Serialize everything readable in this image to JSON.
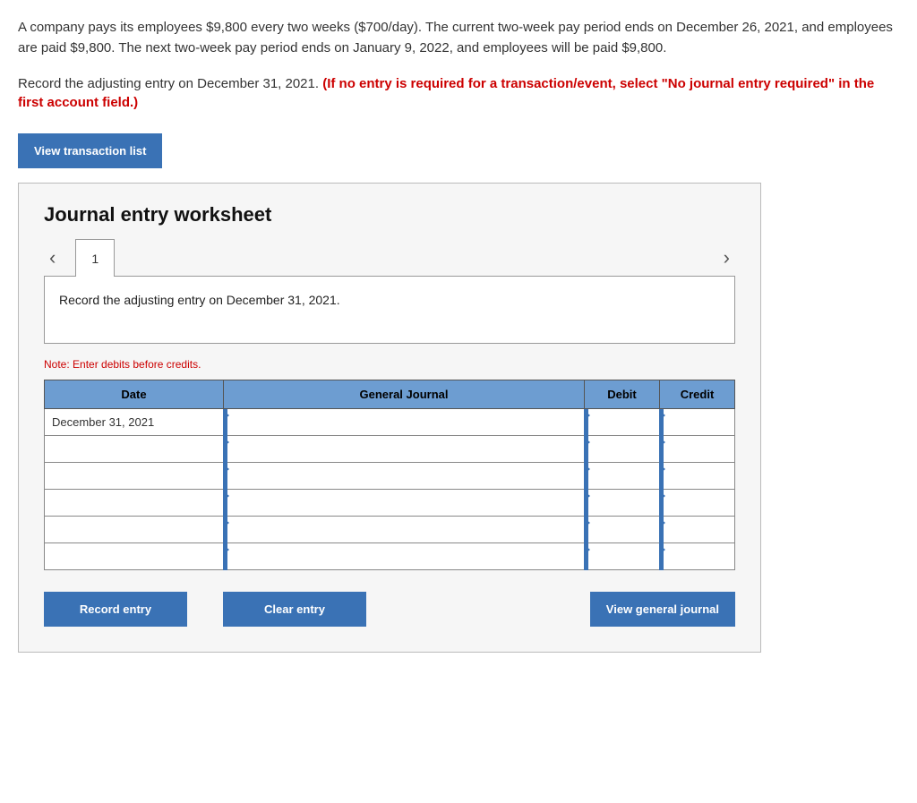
{
  "problem": {
    "paragraph1": "A company pays its employees $9,800 every two weeks ($700/day). The current two-week pay period ends on December 26, 2021, and employees are paid $9,800. The next two-week pay period ends on January 9, 2022, and employees will be paid $9,800.",
    "instruction_plain": "Record the adjusting entry on December 31, 2021. ",
    "instruction_red": "(If no entry is required for a transaction/event, select \"No journal entry required\" in the first account field.)"
  },
  "buttons": {
    "view_transaction_list": "View transaction list",
    "record_entry": "Record entry",
    "clear_entry": "Clear entry",
    "view_general_journal": "View general journal"
  },
  "worksheet": {
    "title": "Journal entry worksheet",
    "tab_label": "1",
    "step_instruction": "Record the adjusting entry on December 31, 2021.",
    "note": "Note: Enter debits before credits.",
    "headers": {
      "date": "Date",
      "general_journal": "General Journal",
      "debit": "Debit",
      "credit": "Credit"
    },
    "rows": [
      {
        "date": "December 31, 2021",
        "gj": "",
        "debit": "",
        "credit": ""
      },
      {
        "date": "",
        "gj": "",
        "debit": "",
        "credit": ""
      },
      {
        "date": "",
        "gj": "",
        "debit": "",
        "credit": ""
      },
      {
        "date": "",
        "gj": "",
        "debit": "",
        "credit": ""
      },
      {
        "date": "",
        "gj": "",
        "debit": "",
        "credit": ""
      },
      {
        "date": "",
        "gj": "",
        "debit": "",
        "credit": ""
      }
    ]
  }
}
